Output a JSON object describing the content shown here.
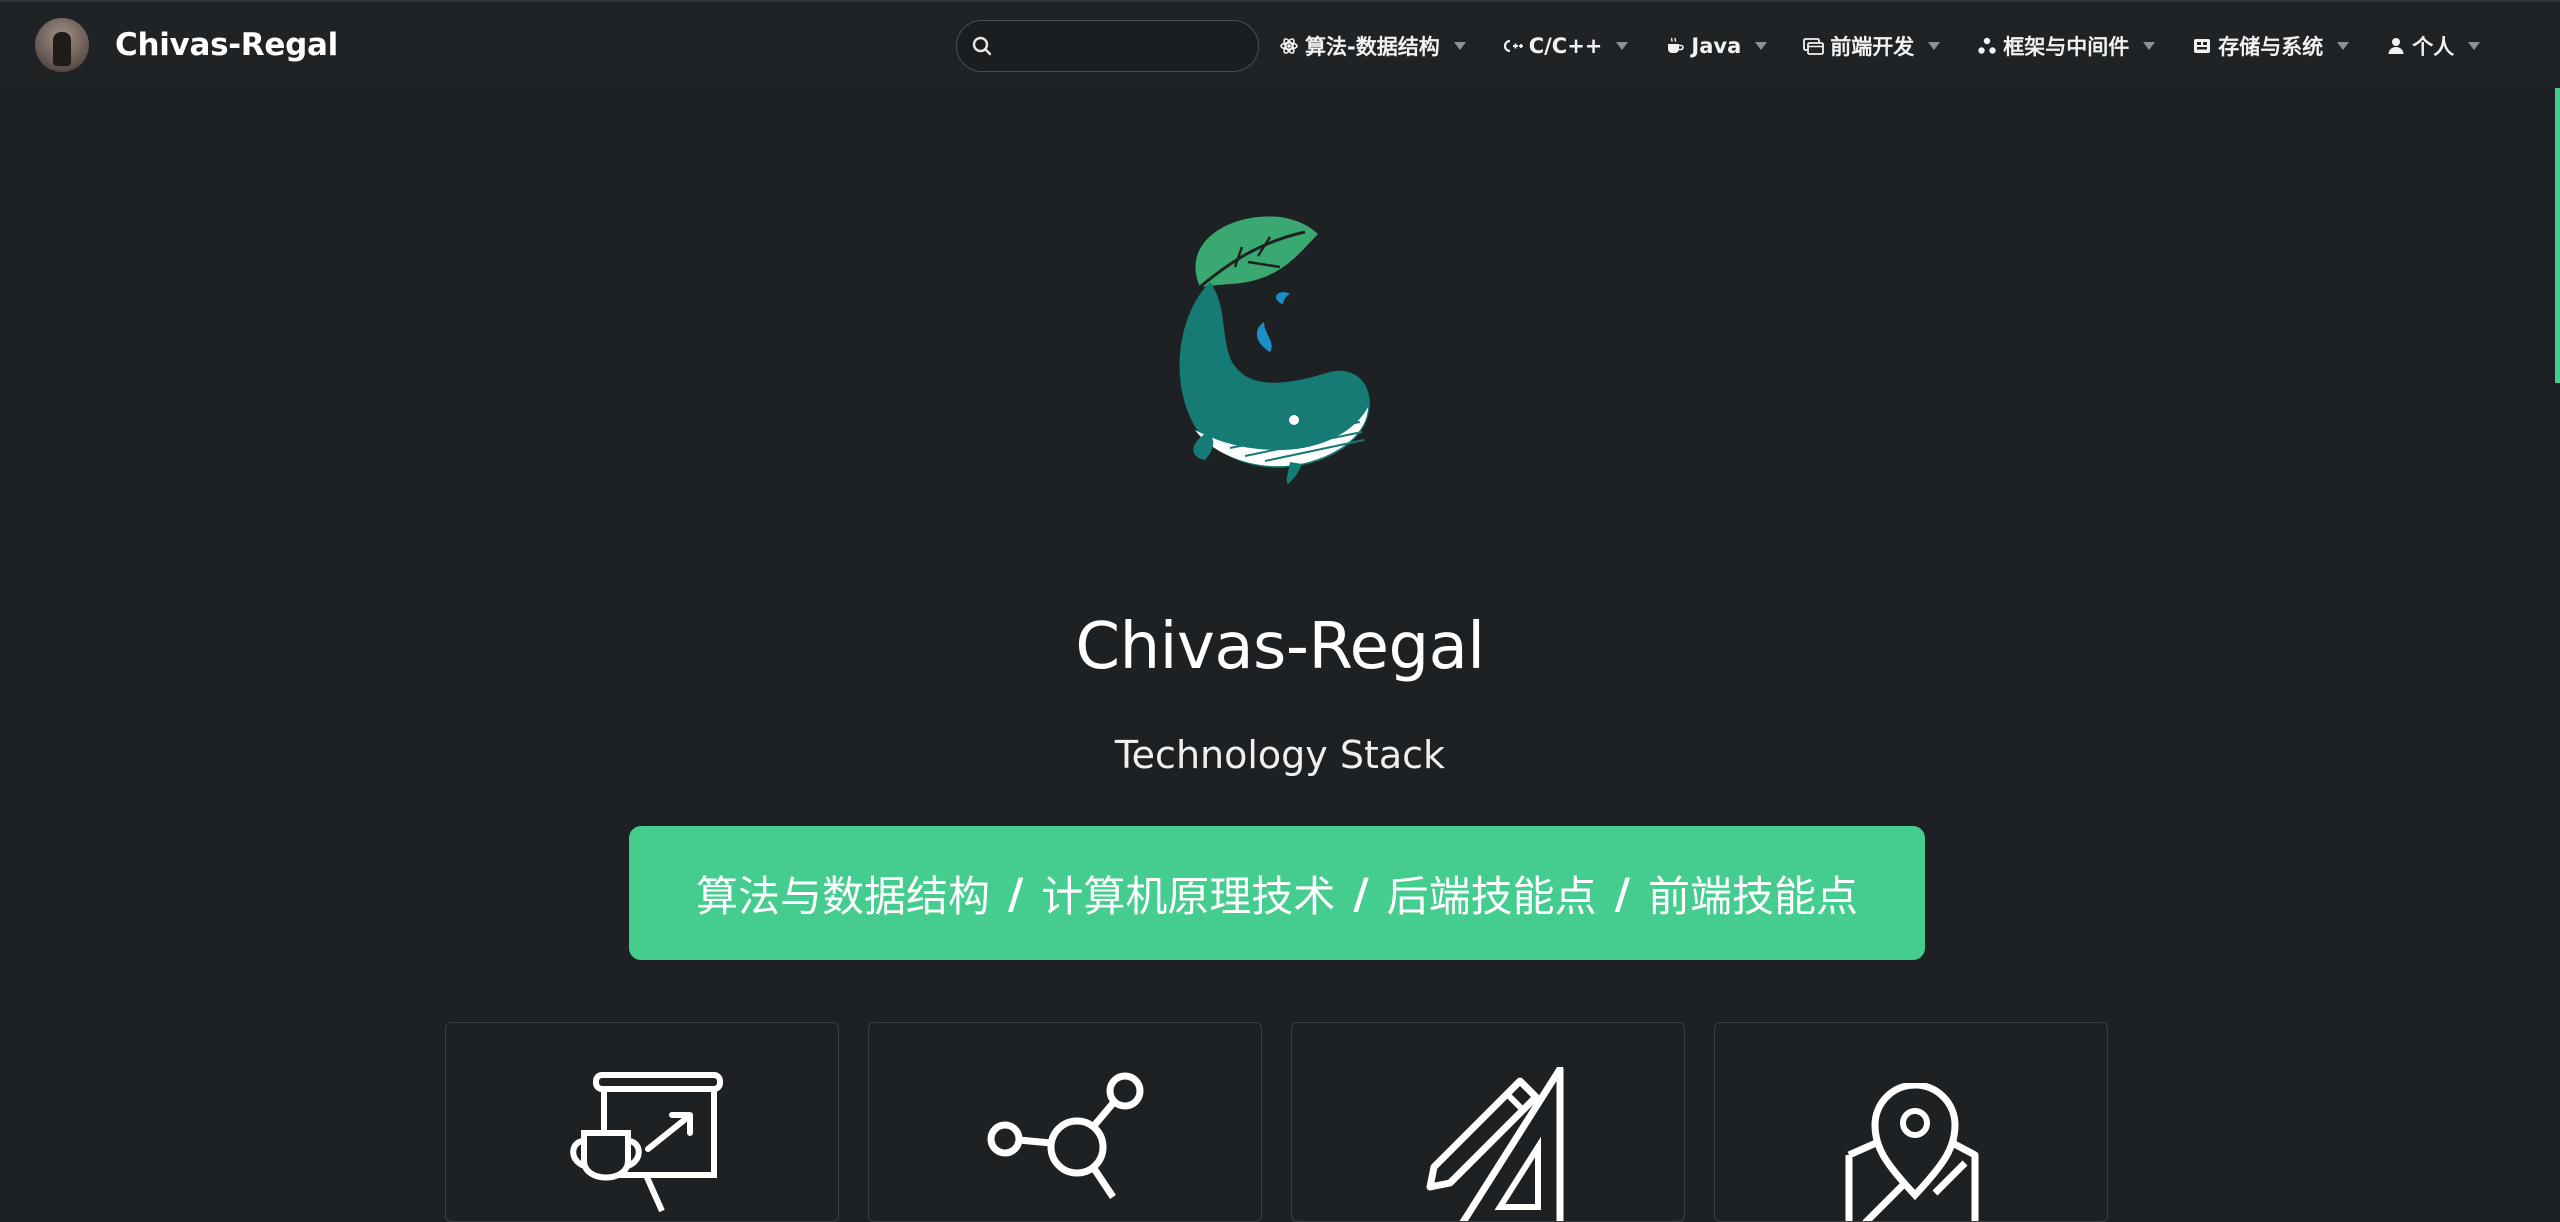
{
  "brand": {
    "name": "Chivas-Regal",
    "avatar_icon": "cat-avatar"
  },
  "search": {
    "placeholder": "",
    "value": ""
  },
  "nav": [
    {
      "label": "算法-数据结构",
      "icon": "atom-icon"
    },
    {
      "label": "C/C++",
      "icon": "cpp-icon"
    },
    {
      "label": "Java",
      "icon": "coffee-cup-icon"
    },
    {
      "label": "前端开发",
      "icon": "window-icon"
    },
    {
      "label": "框架与中间件",
      "icon": "hierarchy-icon"
    },
    {
      "label": "存储与系统",
      "icon": "storage-icon"
    },
    {
      "label": "个人",
      "icon": "user-icon"
    }
  ],
  "hero": {
    "logo_icon": "whale-leaf-logo",
    "title": "Chivas-Regal",
    "subtitle": "Technology Stack"
  },
  "banner": {
    "items": [
      "算法与数据结构",
      "计算机原理技术",
      "后端技能点",
      "前端技能点"
    ],
    "separator": "/"
  },
  "cards": [
    {
      "icon": "presentation-trophy-icon"
    },
    {
      "icon": "share-nodes-icon"
    },
    {
      "icon": "pencil-ruler-icon"
    },
    {
      "icon": "map-pin-icon"
    }
  ],
  "colors": {
    "background": "#1e2124",
    "navbar": "#1f2326",
    "accent": "#44cd8e",
    "logo_green": "#3aa871",
    "logo_teal": "#157b74",
    "logo_blue": "#1a8fc4"
  }
}
